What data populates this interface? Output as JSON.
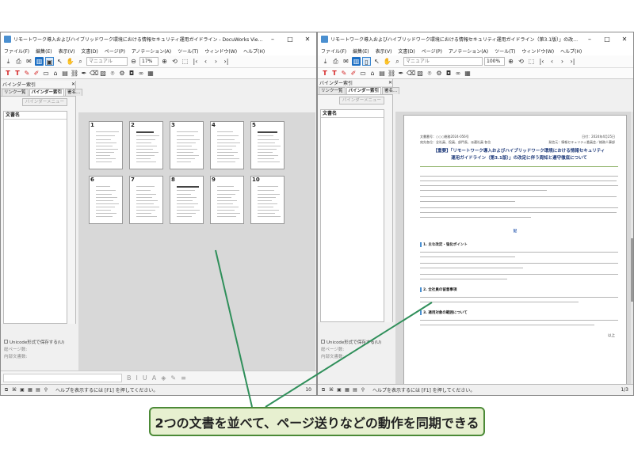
{
  "left": {
    "title": "リモートワーク導入およびハイブリッドワーク環境における情報セキュリティ運用ガイドライン - DocuWorks Viewer",
    "menus": [
      "ファイル(F)",
      "編集(E)",
      "表示(V)",
      "文書(D)",
      "ページ(P)",
      "アノテーション(A)",
      "ツール(T)",
      "ウィンドウ(W)",
      "ヘルプ(H)"
    ],
    "search_placeholder": "マニュアル",
    "zoom": "17%",
    "sidebar": {
      "header": "バインダー索引",
      "tabs": [
        "リンク一覧",
        "バインダー索引",
        "署名..."
      ],
      "menu_button": "バインダーメニュー",
      "column": "文書名",
      "unicode_option": "Unicode形式で保存する(U)",
      "total_pages": "総ページ数:",
      "doc_name": "内部文書数:"
    },
    "thumbs": [
      "1",
      "2",
      "3",
      "4",
      "5",
      "6",
      "7",
      "8",
      "9",
      "10"
    ],
    "status": "ヘルプを表示するには [F1] を押してください。",
    "page_indicator": "10"
  },
  "right": {
    "title": "リモートワーク導入およびハイブリッドワーク環境における情報セキュリティ運用ガイドライン（第3.1版）」の改定に伴う周知と遵守徹底について - DocuWo...",
    "menus": [
      "ファイル(F)",
      "編集(E)",
      "表示(V)",
      "文書(D)",
      "ページ(P)",
      "アノテーション(A)",
      "ツール(T)",
      "ウィンドウ(W)",
      "ヘルプ(H)"
    ],
    "search_placeholder": "マニュアル",
    "zoom": "100%",
    "sidebar": {
      "header": "バインダー索引",
      "tabs": [
        "リンク一覧",
        "バインダー索引",
        "署名..."
      ],
      "menu_button": "バインダーメニュー",
      "column": "文書名",
      "unicode_option": "Unicode形式で保存する(U)",
      "total_pages": "総ページ数:",
      "doc_name": "内部文書数:"
    },
    "doc": {
      "meta_left": "文書番号：○○○総務2024-056号",
      "meta_right": "日付：2024年4月25日",
      "to": "宛先各位：全社員、役員、部門長、派遣社員 各位",
      "from": "発信元：情報セキュリティ委員会／総務人事部",
      "title_line1": "【重要】「リモートワーク導入およびハイブリッドワーク環境における情報セキュリティ",
      "title_line2": "運用ガイドライン（第3.1版）」の改定に伴う周知と遵守徹底について",
      "center": "記",
      "heading1": "1. 主な改定・強化ポイント",
      "heading2": "2. 全社員の留意事項",
      "heading3": "3. 適用対象の範囲について",
      "closing": "以上"
    },
    "status": "ヘルプを表示するには [F1] を押してください。",
    "page_indicator": "1/3"
  },
  "callout": "2つの文書を並べて、ページ送りなどの動作を同期できる",
  "colors": {
    "accent_green": "#4c8a37",
    "callout_bg": "#e7f0d0",
    "title_blue": "#1e3a7a"
  }
}
